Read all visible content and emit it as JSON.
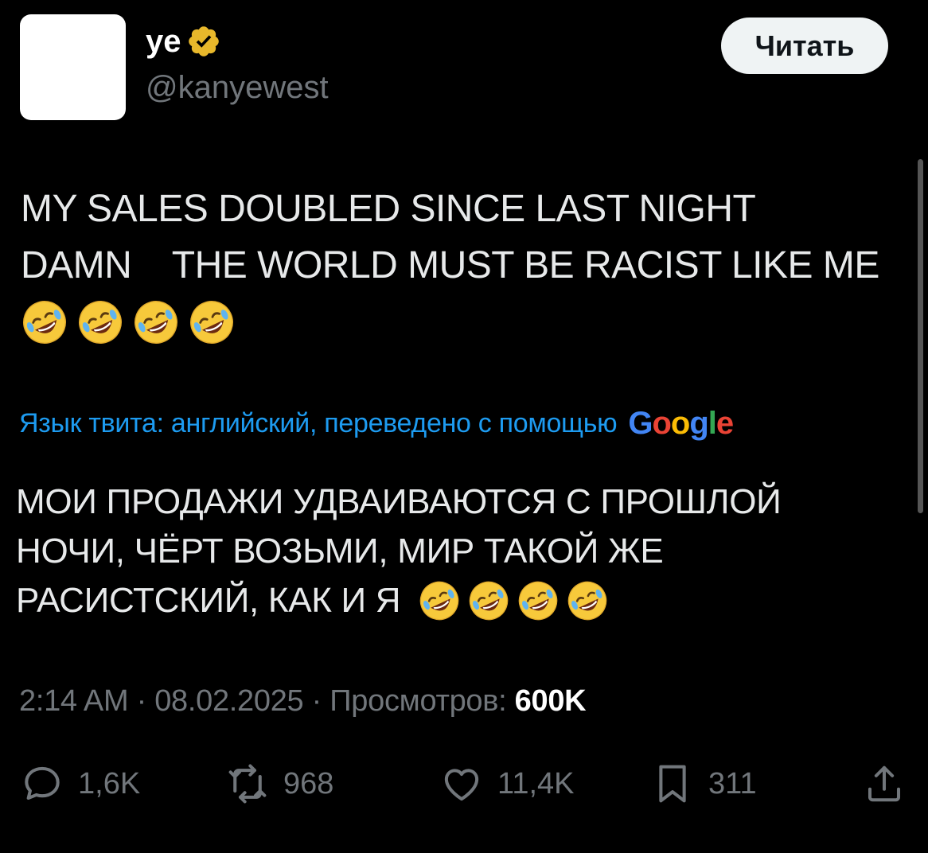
{
  "author": {
    "display_name": "ye",
    "handle": "@kanyewest",
    "verified_color": "#e8b82b"
  },
  "follow_button": {
    "label": "Читать"
  },
  "tweet": {
    "lines": [
      "MY SALES DOUBLED SINCE LAST NIGHT",
      "DAMN    THE WORLD MUST BE RACIST LIKE ME"
    ],
    "emoji": [
      "🤣",
      "🤣",
      "🤣",
      "🤣"
    ]
  },
  "translation": {
    "note": "Язык твита: английский, переведено с помощью",
    "provider": "Google",
    "lines": [
      "МОИ ПРОДАЖИ УДВАИВАЮТСЯ С ПРОШЛОЙ",
      "НОЧИ, ЧЁРТ ВОЗЬМИ, МИР ТАКОЙ ЖЕ",
      "РАСИСТСКИЙ, КАК И Я"
    ]
  },
  "meta": {
    "time": "2:14 AM",
    "separator": " · ",
    "date": "08.02.2025",
    "views_label": "Просмотров:",
    "views_count": "600K"
  },
  "actions": {
    "replies": "1,6K",
    "reposts": "968",
    "likes": "11,4K",
    "bookmarks": "311"
  },
  "colors": {
    "background": "#000000",
    "text": "#e7e9ea",
    "muted": "#71767b",
    "link": "#1d9bf0"
  }
}
